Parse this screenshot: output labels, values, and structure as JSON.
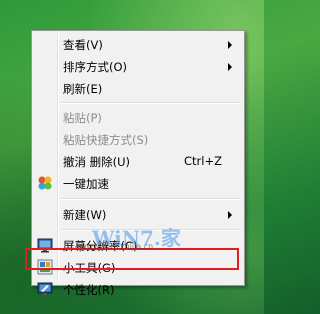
{
  "menu": {
    "items": [
      {
        "label": "查看(V)",
        "submenu": true
      },
      {
        "label": "排序方式(O)",
        "submenu": true
      },
      {
        "label": "刷新(E)"
      },
      {
        "label": "粘贴(P)",
        "disabled": true
      },
      {
        "label": "粘贴快捷方式(S)",
        "disabled": true
      },
      {
        "label": "撤消 删除(U)",
        "shortcut": "Ctrl+Z"
      },
      {
        "label": "一键加速",
        "icon": "accelerate-icon"
      },
      {
        "label": "新建(W)",
        "submenu": true
      },
      {
        "label": "屏幕分辨率(C)",
        "icon": "display-icon"
      },
      {
        "label": "小工具(G)",
        "icon": "gadgets-icon"
      },
      {
        "label": "个性化(R)",
        "icon": "personalize-icon"
      }
    ]
  },
  "watermark": {
    "text": "WiN7.家",
    "url": "www.win7zhijia.cn"
  },
  "colors": {
    "highlight": "#e11d1d",
    "desktop": "#2f9a3a"
  }
}
